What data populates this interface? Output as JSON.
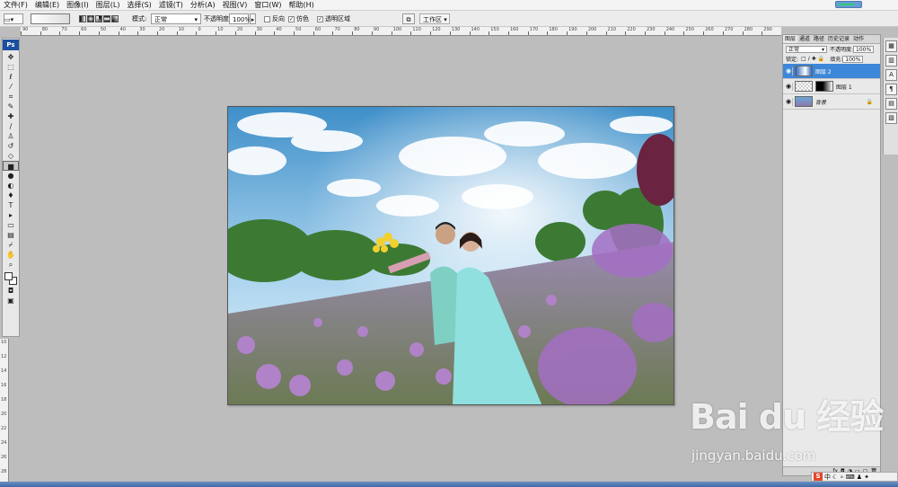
{
  "menu": {
    "items": [
      "文件(F)",
      "编辑(E)",
      "图像(I)",
      "图层(L)",
      "选择(S)",
      "滤镜(T)",
      "分析(A)",
      "视图(V)",
      "窗口(W)",
      "帮助(H)"
    ]
  },
  "options_bar": {
    "mode_label": "模式:",
    "mode_value": "正常",
    "opacity_label": "不透明度:",
    "opacity_value": "100%",
    "reverse_label": "反向",
    "dither_label": "仿色",
    "transparency_label": "透明区域",
    "workspace_label": "工作区"
  },
  "ruler": {
    "top_ticks": [
      "90",
      "80",
      "70",
      "60",
      "50",
      "40",
      "30",
      "20",
      "10",
      "0",
      "10",
      "20",
      "30",
      "40",
      "50",
      "60",
      "70",
      "80",
      "90",
      "100",
      "110",
      "120",
      "130",
      "140",
      "150",
      "160",
      "170",
      "180",
      "190",
      "200",
      "210",
      "220",
      "230",
      "240",
      "250",
      "260",
      "270",
      "280",
      "290"
    ],
    "left_ticks": [
      "10",
      "12",
      "14",
      "16",
      "18",
      "20",
      "22",
      "24",
      "26",
      "28"
    ]
  },
  "toolbox": {
    "logo": "Ps",
    "tools": [
      "move",
      "marquee",
      "lasso",
      "magic-wand",
      "crop",
      "slice",
      "healing",
      "brush",
      "stamp",
      "history-brush",
      "eraser",
      "gradient",
      "blur",
      "dodge",
      "pen",
      "type",
      "path-select",
      "shape",
      "notes",
      "eyedropper",
      "hand",
      "zoom"
    ]
  },
  "layers_panel": {
    "tabs": [
      "图层",
      "通道",
      "路径",
      "历史记录",
      "动作"
    ],
    "blend_mode": "正常",
    "opacity_label": "不透明度:",
    "opacity_value": "100%",
    "lock_label": "锁定:",
    "fill_label": "填充:",
    "fill_value": "100%",
    "layers": [
      {
        "name": "图层 2",
        "selected": true
      },
      {
        "name": "图层 1",
        "selected": false
      },
      {
        "name": "背景",
        "selected": false
      }
    ],
    "bottom_icons": "fx"
  },
  "watermark": {
    "logo_text": "Bai du 经验",
    "url": "jingyan.baidu.com"
  },
  "tray": {
    "ime": "S",
    "lang": "中"
  },
  "colors": {
    "selected_layer": "#3d87d8",
    "canvas_bg": "#bdbdbd",
    "ps_logo": "#1c4fa0"
  }
}
